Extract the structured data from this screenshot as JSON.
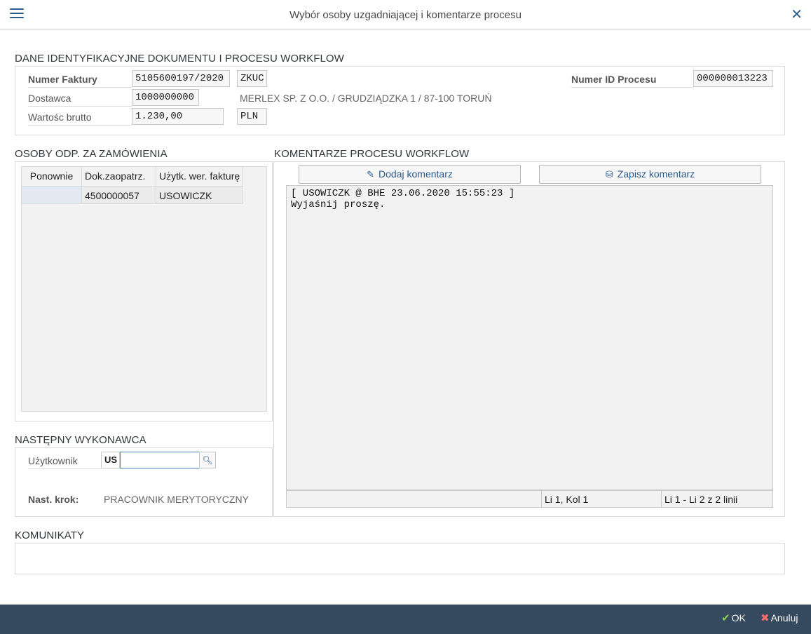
{
  "window": {
    "title": "Wybór osoby uzgadniającej i komentarze procesu",
    "close_glyph": "✕"
  },
  "doc_section": {
    "title": "DANE IDENTYFIKACYJNE DOKUMENTU I PROCESU WORKFLOW",
    "invoice_label": "Numer Faktury",
    "invoice_value": "5105600197/2020",
    "invoice_type": "ZKUC",
    "vendor_label": "Dostawca",
    "vendor_value": "1000000000",
    "vendor_name": "MERLEX SP. Z O.O. / GRUDZIĄDZKA 1 / 87-100 TORUŃ",
    "gross_label": "Wartośc brutto",
    "gross_value": "1.230,00",
    "currency": "PLN",
    "process_id_label": "Numer ID Procesu",
    "process_id_value": "000000013223"
  },
  "persons_section": {
    "title": "OSOBY ODP. ZA ZAMÓWIENIA",
    "columns": [
      "Ponownie",
      "Dok.zaopatrz.",
      "Użytk. wer. fakturę"
    ],
    "rows": [
      [
        "",
        "4500000057",
        "USOWICZK"
      ]
    ]
  },
  "comments_section": {
    "title": "KOMENTARZE PROCESU WORKFLOW",
    "add_label": "Dodaj komentarz",
    "save_label": "Zapisz komentarz",
    "text_line1": "[ USOWICZK @ BHE 23.06.2020 15:55:23 ]",
    "text_line2": "Wyjaśnij proszę.",
    "status_pos": "Li 1, Kol 1",
    "status_lines": "Li 1 - Li 2 z 2 linii"
  },
  "next_section": {
    "title": "NASTĘPNY WYKONAWCA",
    "user_label": "Użytkownik",
    "user_prefix": "US",
    "user_value": "",
    "step_label": "Nast. krok:",
    "step_value": "PRACOWNIK MERYTORYCZNY"
  },
  "messages_section": {
    "title": "KOMUNIKATY"
  },
  "footer": {
    "ok_label": "OK",
    "cancel_label": "Anuluj"
  },
  "colors": {
    "accent": "#2a5a8c",
    "footer_bg": "#354a5f",
    "ok_icon": "#8fd14f",
    "cancel_icon": "#ff6b6b"
  }
}
